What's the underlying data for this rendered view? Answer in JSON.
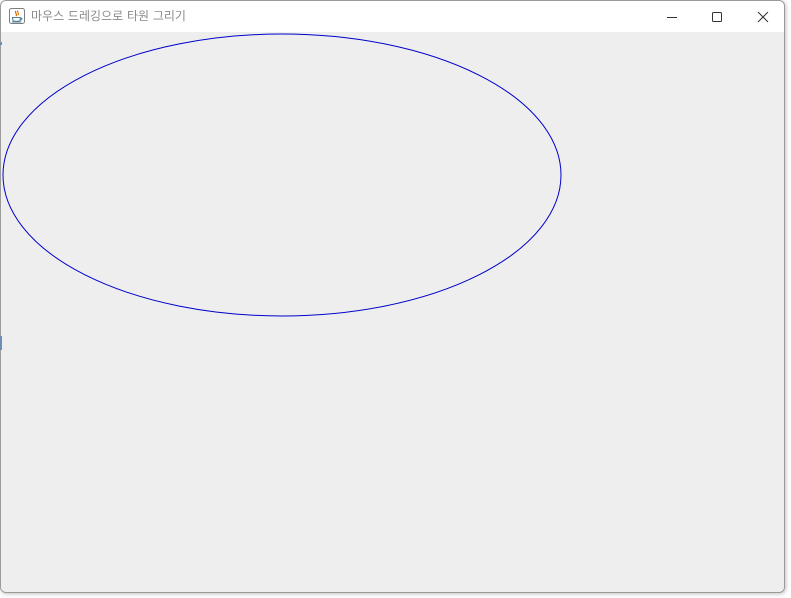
{
  "window": {
    "title": "마우스 드레깅으로 타원 그리기",
    "app_icon": "java-cup-icon",
    "controls": {
      "minimize_icon": "minimize-icon",
      "maximize_icon": "maximize-icon",
      "close_icon": "close-icon"
    }
  },
  "canvas": {
    "background": "#eeeeee",
    "ellipse": {
      "stroke_color": "#0000cc"
    }
  }
}
